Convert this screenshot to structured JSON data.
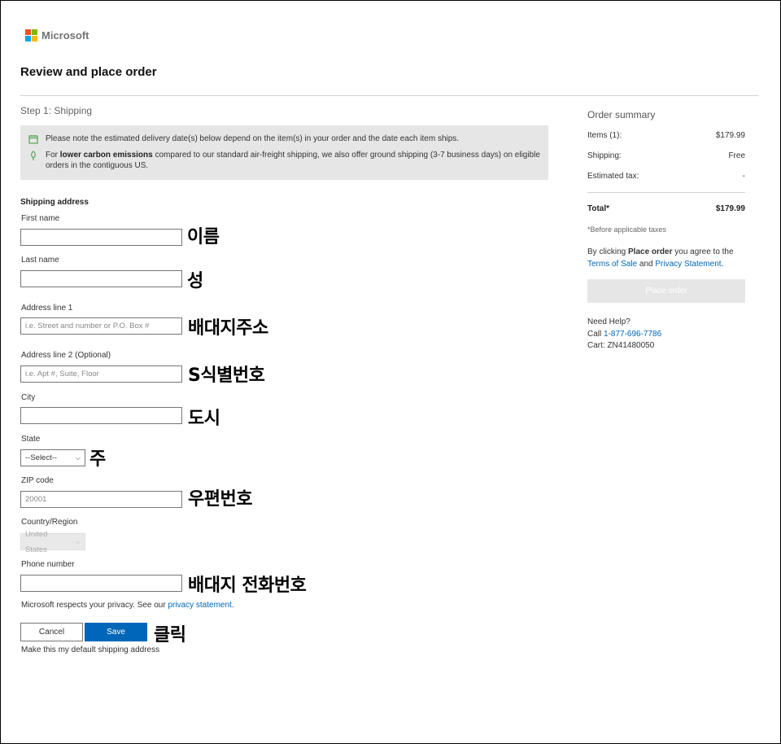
{
  "brand": {
    "name": "Microsoft",
    "logo_colors": [
      "#f25022",
      "#7fba00",
      "#00a4ef",
      "#ffb900"
    ]
  },
  "page": {
    "title": "Review and place order",
    "step": "Step 1: Shipping"
  },
  "notice": {
    "line1": "Please note the estimated delivery date(s) below depend on the item(s) in your order and the date each item ships.",
    "line2_prefix": "For ",
    "line2_bold": "lower carbon emissions",
    "line2_suffix": " compared to our standard air-freight shipping, we also offer ground shipping (3-7 business days) on eligible orders in the contiguous US.",
    "icons": [
      "calendar-icon",
      "leaf-pin-icon"
    ]
  },
  "form": {
    "section_label": "Shipping address",
    "first_name": {
      "label": "First name",
      "value": "",
      "annotation": "이름"
    },
    "last_name": {
      "label": "Last name",
      "value": "",
      "annotation": "성"
    },
    "address1": {
      "label": "Address line 1",
      "placeholder": "i.e. Street and number or P.O. Box #",
      "annotation": "배대지주소"
    },
    "address2": {
      "label": "Address line 2 (Optional)",
      "placeholder": "i.e. Apt #, Suite, Floor",
      "annotation": "S식별번호"
    },
    "city": {
      "label": "City",
      "value": "",
      "annotation": "도시"
    },
    "state": {
      "label": "State",
      "selected": "--Select--",
      "annotation": "주"
    },
    "zip": {
      "label": "ZIP code",
      "placeholder": "20001",
      "annotation": "우편번호"
    },
    "country": {
      "label": "Country/Region",
      "selected": "United States"
    },
    "phone": {
      "label": "Phone number",
      "value": "",
      "annotation": "배대지 전화번호"
    },
    "privacy_prefix": "Microsoft respects your privacy. See our ",
    "privacy_link": "privacy statement",
    "privacy_suffix": ".",
    "cancel_label": "Cancel",
    "save_label": "Save",
    "save_annotation": "클릭",
    "default_label": "Make this my default shipping address"
  },
  "summary": {
    "title": "Order summary",
    "items_label": "Items (1):",
    "items_value": "$179.99",
    "shipping_label": "Shipping:",
    "shipping_value": "Free",
    "tax_label": "Estimated tax:",
    "tax_value": "-",
    "total_label": "Total*",
    "total_value": "$179.99",
    "tax_note": "*Before applicable taxes",
    "agree_prefix": "By clicking ",
    "agree_bold": "Place order",
    "agree_mid": " you agree to the",
    "terms_link": "Terms of Sale",
    "and": "and",
    "privacy_link": "Privacy Statement",
    "period": ".",
    "place_order_label": "Place order",
    "help_title": "Need Help?",
    "call_label": "Call",
    "phone": "1-877-696-7786",
    "cart_label": "Cart:",
    "cart_id": "ZN41480050"
  }
}
